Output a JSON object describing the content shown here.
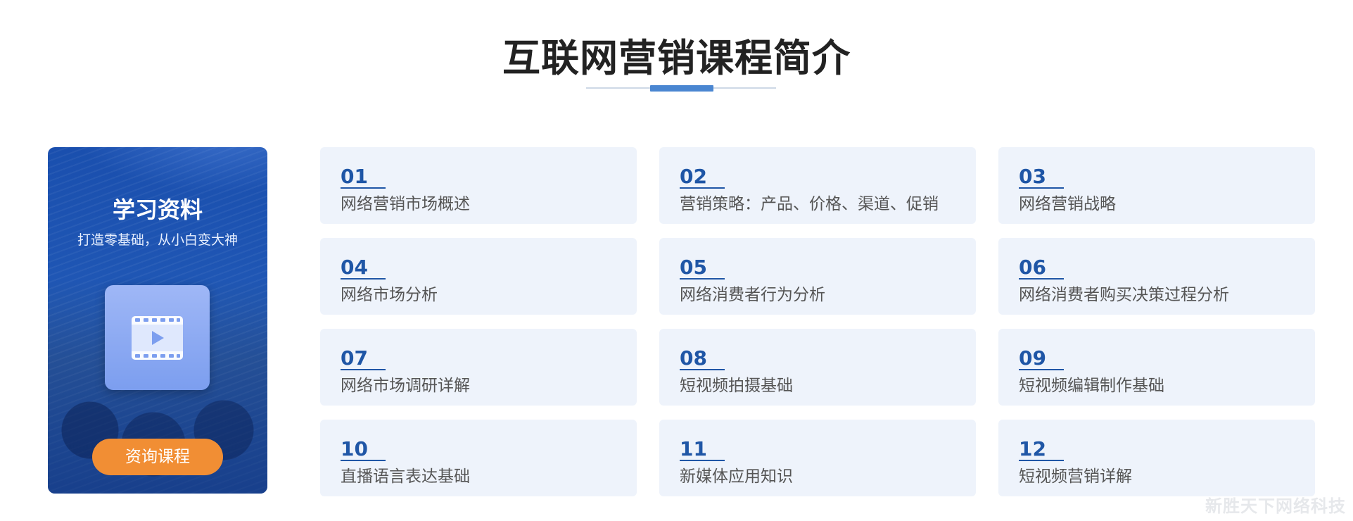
{
  "header": {
    "title": "互联网营销课程简介"
  },
  "promo": {
    "title": "学习资料",
    "subtitle": "打造零基础，从小白变大神",
    "icon": "video-play-icon",
    "button_label": "资询课程",
    "button_color": "#f18e34"
  },
  "courses": [
    {
      "num": "01",
      "name": "网络营销市场概述"
    },
    {
      "num": "02",
      "name": "营销策略：产品、价格、渠道、促销"
    },
    {
      "num": "03",
      "name": "网络营销战略"
    },
    {
      "num": "04",
      "name": "网络市场分析"
    },
    {
      "num": "05",
      "name": "网络消费者行为分析"
    },
    {
      "num": "06",
      "name": "网络消费者购买决策过程分析"
    },
    {
      "num": "07",
      "name": "网络市场调研详解"
    },
    {
      "num": "08",
      "name": "短视频拍摄基础"
    },
    {
      "num": "09",
      "name": "短视频编辑制作基础"
    },
    {
      "num": "10",
      "name": "直播语言表达基础"
    },
    {
      "num": "11",
      "name": "新媒体应用知识"
    },
    {
      "num": "12",
      "name": "短视频营销详解"
    }
  ],
  "watermark": "新胜天下网络科技",
  "colors": {
    "accent": "#4a86d1",
    "number": "#1f56a6",
    "card_bg": "#eef3fb"
  }
}
